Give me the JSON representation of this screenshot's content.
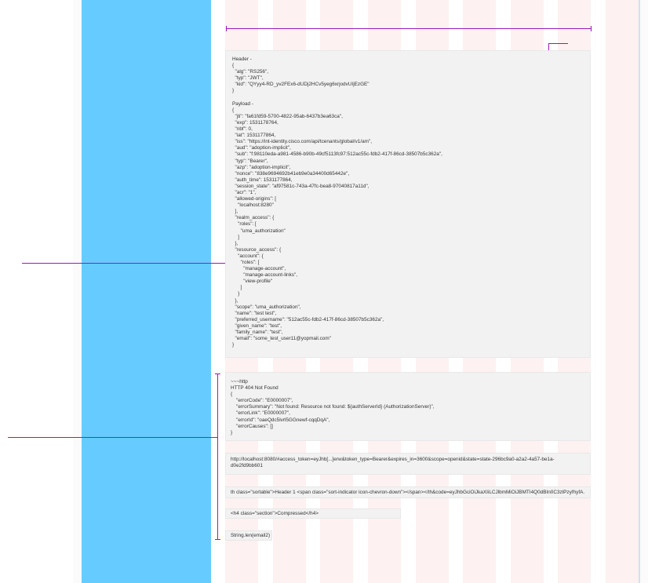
{
  "jwt_block": {
    "lines": [
      "Header -",
      "{",
      "  \"alg\": \"RS256\",",
      "  \"typ\": \"JWT\",",
      "  \"kid\": \"QYyy4-RD_yv2FEx6-dUDj2HCv5yeg6xrjodvUIjEzGE\"",
      "}",
      "",
      "Payload -",
      "{",
      "  \"jti\": \"fa61fd59-5700-4822-95ab-6437b3ea63ca\",",
      "  \"exp\": 1531178764,",
      "  \"nbf\": 0,",
      "  \"iat\": 1531177864,",
      "  \"iss\": \"https://int-identity.cisco.com/api/tcenants/global/v1/am\",",
      "  \"aud\": \"adoption-implicit\",",
      "  \"sub\": \"f:98110eda-a981-4586-b90b-49cf5113fc97:512ac55c-fdb2-417f-86cd-38507b5c362a\",",
      "  \"typ\": \"Bearer\",",
      "  \"azp\": \"adoption-implicit\",",
      "  \"nonce\": \"838e9694692b41eb9e0a34400d65442e\",",
      "  \"auth_time\": 1531177864,",
      "  \"session_state\": \"af97581c-743a-47fc-bea8-97040817a11d\",",
      "  \"acr\": \"1\",",
      "  \"allowed-origins\": [",
      "    \"localhost:8280\"",
      "  ],",
      "  \"realm_access\": {",
      "    \"roles\": [",
      "      \"uma_authorization\"",
      "    ]",
      "  },",
      "  \"resource_access\": {",
      "    \"account\": {",
      "      \"roles\": [",
      "        \"manage-account\",",
      "        \"manage-account-links\",",
      "        \"view-profile\"",
      "      ]",
      "    }",
      "  },",
      "  \"scope\": \"uma_authorization\",",
      "  \"name\": \"test test\",",
      "  \"preferred_username\": \"512ac55c-fdb2-417f-86cd-38507b5c362a\",",
      "  \"given_name\": \"test\",",
      "  \"family_name\": \"test\",",
      "  \"email\": \"some_test_user11@yopmail.com\"",
      "}"
    ]
  },
  "http_block": {
    "lines": [
      "~~~http",
      "HTTP 404 Not Found",
      "{",
      "    \"errorCode\": \"E0000007\",",
      "    \"errorSummary\": \"Not found: Resource not found: ${authServerId} (AuthorizationServer)\",",
      "    \"errorLink\": \"E0000007\",",
      "    \"errorId\": \"oaeQdc5lvrl5GGnewf-cqqDqA\",",
      "    \"errorCauses\": []",
      "}"
    ]
  },
  "url_block": {
    "text": "http://localhost:8080/#access_token=eyJhb[...]erw&token_type=Bearer&expires_in=3600&scope=openid&state=state-296bc9a0-a2a2-4a57-be1a-d0e2fd9bb601"
  },
  "th_block": {
    "text": "th class=\"sortable\">Header 1 <span class=\"sort-indicator icon-chevron-down\"></span></th&code=eyJhbGciOiJkaXIiLCJlbmMiOiJBMTI4Q0dBIn0C3zlPzyfhyfA."
  },
  "h4_block": {
    "text": "<h4 class=\"section\">Compressed</h4>"
  },
  "string_block": {
    "text": "String.len(email2)"
  }
}
